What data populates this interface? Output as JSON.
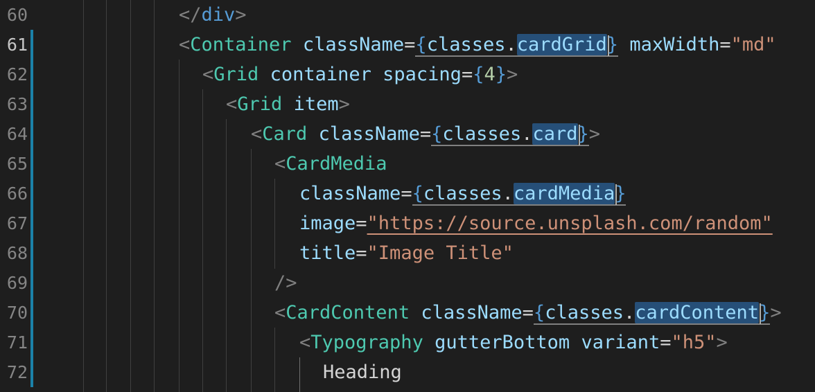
{
  "editor": {
    "lines": [
      {
        "num": "60",
        "parts": [
          "</",
          "div",
          ">"
        ]
      },
      {
        "num": "61",
        "parts": [
          "<",
          "Container",
          " ",
          "className",
          "=",
          "{",
          "classes",
          ".",
          "cardGrid",
          "}",
          " ",
          "maxWidth",
          "=",
          "\"md\""
        ]
      },
      {
        "num": "62",
        "parts": [
          "<",
          "Grid",
          " ",
          "container",
          " ",
          "spacing",
          "=",
          "{",
          "4",
          "}",
          ">"
        ]
      },
      {
        "num": "63",
        "parts": [
          "<",
          "Grid",
          " ",
          "item",
          ">"
        ]
      },
      {
        "num": "64",
        "parts": [
          "<",
          "Card",
          " ",
          "className",
          "=",
          "{",
          "classes",
          ".",
          "card",
          "}",
          ">"
        ]
      },
      {
        "num": "65",
        "parts": [
          "<",
          "CardMedia"
        ]
      },
      {
        "num": "66",
        "parts": [
          "className",
          "=",
          "{",
          "classes",
          ".",
          "cardMedia",
          "}"
        ]
      },
      {
        "num": "67",
        "parts": [
          "image",
          "=",
          "\"https://source.unsplash.com/random\""
        ]
      },
      {
        "num": "68",
        "parts": [
          "title",
          "=",
          "\"Image Title\""
        ]
      },
      {
        "num": "69",
        "parts": [
          "/>"
        ]
      },
      {
        "num": "70",
        "parts": [
          "<",
          "CardContent",
          " ",
          "className",
          "=",
          "{",
          "classes",
          ".",
          "cardContent",
          "}",
          ">"
        ]
      },
      {
        "num": "71",
        "parts": [
          "<",
          "Typography",
          " ",
          "gutterBottom",
          " ",
          "variant",
          "=",
          "\"h5\"",
          ">"
        ]
      },
      {
        "num": "72",
        "parts": [
          "Heading"
        ]
      }
    ]
  },
  "colors": {
    "background": "#1e1e1e",
    "git_modified_bar": "#1b81a8",
    "selection_highlight": "#264f78"
  }
}
